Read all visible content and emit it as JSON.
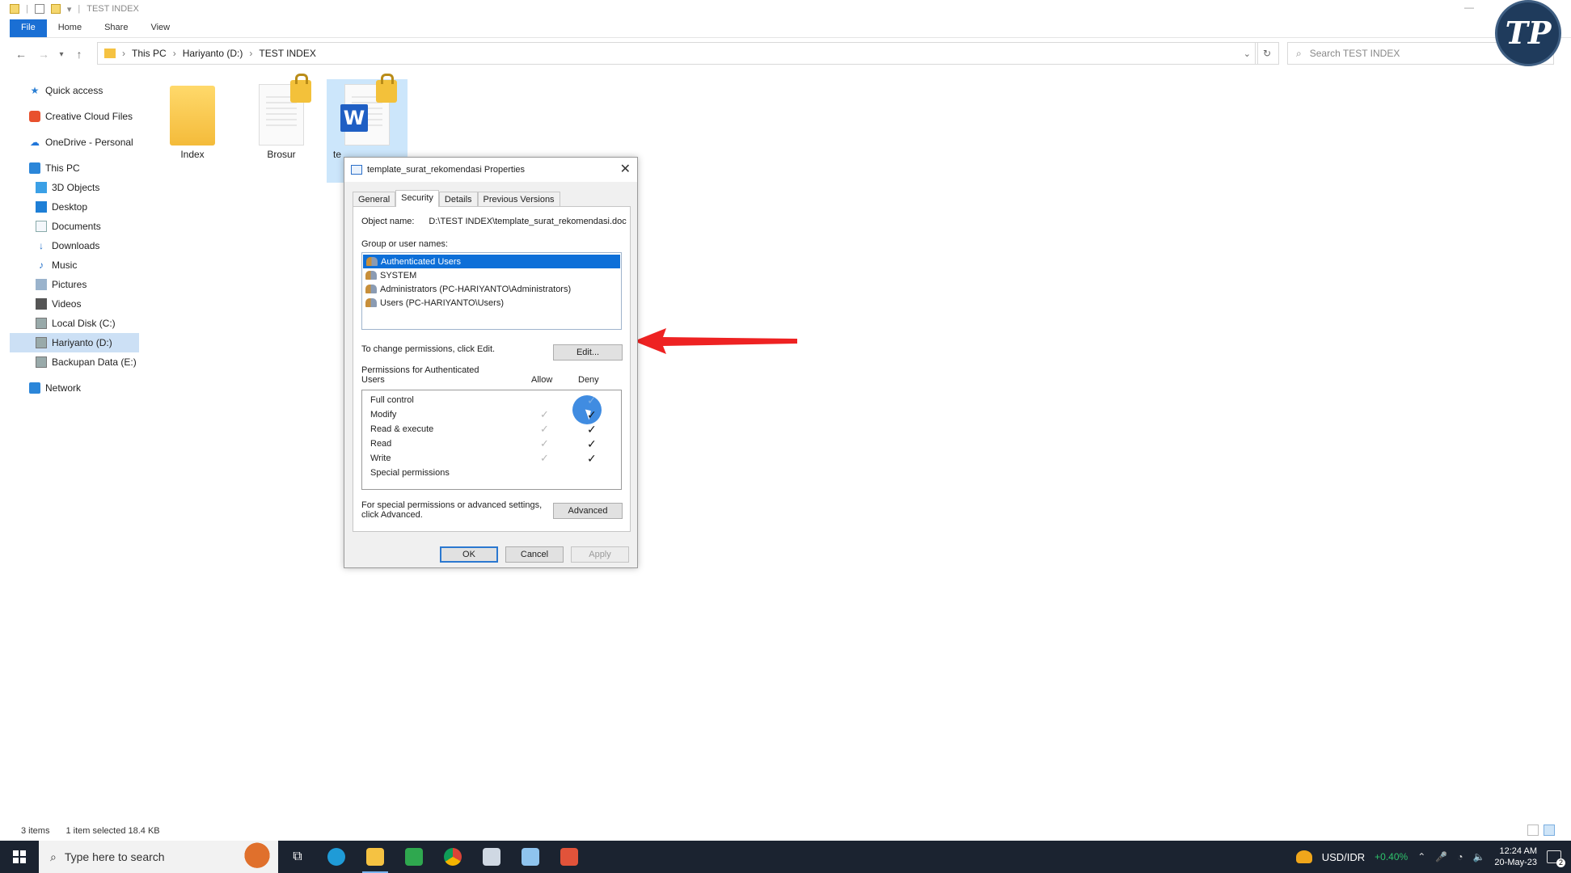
{
  "window": {
    "title": "TEST INDEX"
  },
  "ribbon": {
    "tabs": [
      "File",
      "Home",
      "Share",
      "View"
    ]
  },
  "address": {
    "crumbs": [
      "This PC",
      "Hariyanto (D:)",
      "TEST INDEX"
    ],
    "search_placeholder": "Search TEST INDEX"
  },
  "sidebar": {
    "items": [
      {
        "label": "Quick access",
        "icon": "star-icon"
      },
      {
        "label": "Creative Cloud Files",
        "icon": "creative-cloud-icon"
      },
      {
        "label": "OneDrive - Personal",
        "icon": "onedrive-icon"
      },
      {
        "label": "This PC",
        "icon": "computer-icon"
      },
      {
        "label": "3D Objects",
        "icon": "3d-objects-icon"
      },
      {
        "label": "Desktop",
        "icon": "desktop-icon"
      },
      {
        "label": "Documents",
        "icon": "documents-icon"
      },
      {
        "label": "Downloads",
        "icon": "download-icon"
      },
      {
        "label": "Music",
        "icon": "music-icon"
      },
      {
        "label": "Pictures",
        "icon": "pictures-icon"
      },
      {
        "label": "Videos",
        "icon": "videos-icon"
      },
      {
        "label": "Local Disk (C:)",
        "icon": "drive-icon"
      },
      {
        "label": "Hariyanto (D:)",
        "icon": "drive-icon",
        "selected": true
      },
      {
        "label": "Backupan Data (E:)",
        "icon": "drive-icon"
      },
      {
        "label": "Network",
        "icon": "network-icon"
      }
    ]
  },
  "files": [
    {
      "name": "Index",
      "type": "folder"
    },
    {
      "name": "Brosur",
      "type": "document",
      "locked": true
    },
    {
      "name": "te",
      "type": "word-document",
      "locked": true,
      "selected": true
    }
  ],
  "status": {
    "count": "3 items",
    "selection": "1 item selected  18.4 KB"
  },
  "logo": {
    "text": "TP"
  },
  "dialog": {
    "title": "template_surat_rekomendasi Properties",
    "tabs": [
      "General",
      "Security",
      "Details",
      "Previous Versions"
    ],
    "active_tab": "Security",
    "object_name_label": "Object name:",
    "object_name_value": "D:\\TEST INDEX\\template_surat_rekomendasi.doc",
    "group_label": "Group or user names:",
    "users": [
      "Authenticated Users",
      "SYSTEM",
      "Administrators (PC-HARIYANTO\\Administrators)",
      "Users (PC-HARIYANTO\\Users)"
    ],
    "change_text": "To change permissions, click Edit.",
    "edit_button": "Edit...",
    "perms_label_1": "Permissions for Authenticated",
    "perms_label_2": "Users",
    "allow_header": "Allow",
    "deny_header": "Deny",
    "permissions": [
      {
        "name": "Full control",
        "allow": false,
        "deny": true
      },
      {
        "name": "Modify",
        "allow": true,
        "deny": true
      },
      {
        "name": "Read & execute",
        "allow": true,
        "deny": true
      },
      {
        "name": "Read",
        "allow": true,
        "deny": true
      },
      {
        "name": "Write",
        "allow": true,
        "deny": true
      },
      {
        "name": "Special permissions",
        "allow": false,
        "deny": false
      }
    ],
    "advanced_text_1": "For special permissions or advanced settings,",
    "advanced_text_2": "click Advanced.",
    "advanced_button": "Advanced",
    "ok_button": "OK",
    "cancel_button": "Cancel",
    "apply_button": "Apply"
  },
  "taskbar": {
    "search_placeholder": "Type here to search",
    "apps": [
      "task-view-icon",
      "edge-icon",
      "file-explorer-icon",
      "camtasia-icon",
      "chrome-icon",
      "app-icon",
      "notes-icon",
      "recorder-icon"
    ],
    "ticker": "USD/IDR",
    "ticker_change": "+0.40%",
    "time": "12:24 AM",
    "date": "20-May-23"
  }
}
